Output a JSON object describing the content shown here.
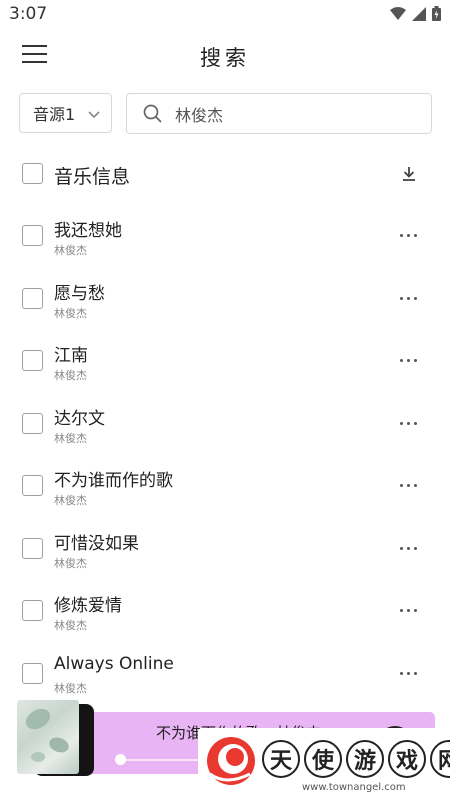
{
  "status_bar": {
    "time": "3:07"
  },
  "app_bar": {
    "title": "搜索"
  },
  "search": {
    "source_label": "音源1",
    "query": "林俊杰"
  },
  "list_header": {
    "title": "音乐信息"
  },
  "songs": [
    {
      "title": "我还想她",
      "artist": "林俊杰"
    },
    {
      "title": "愿与愁",
      "artist": "林俊杰"
    },
    {
      "title": "江南",
      "artist": "林俊杰"
    },
    {
      "title": "达尔文",
      "artist": "林俊杰"
    },
    {
      "title": "不为谁而作的歌",
      "artist": "林俊杰"
    },
    {
      "title": "可惜没如果",
      "artist": "林俊杰"
    },
    {
      "title": "修炼爱情",
      "artist": "林俊杰"
    },
    {
      "title": "Always Online",
      "artist": "林俊杰"
    }
  ],
  "player": {
    "now_playing": "不为谁而作的歌 - 林俊杰",
    "accent_color": "#e9b4f4",
    "progress": 0.0
  },
  "watermark": {
    "chars": [
      "天",
      "使",
      "游",
      "戏",
      "网"
    ],
    "url": "www.townangel.com"
  },
  "icons": [
    "wifi-icon",
    "signal-icon",
    "battery-icon",
    "menu-icon",
    "chevron-down-icon",
    "search-icon",
    "download-icon",
    "more-icon",
    "play-icon"
  ]
}
